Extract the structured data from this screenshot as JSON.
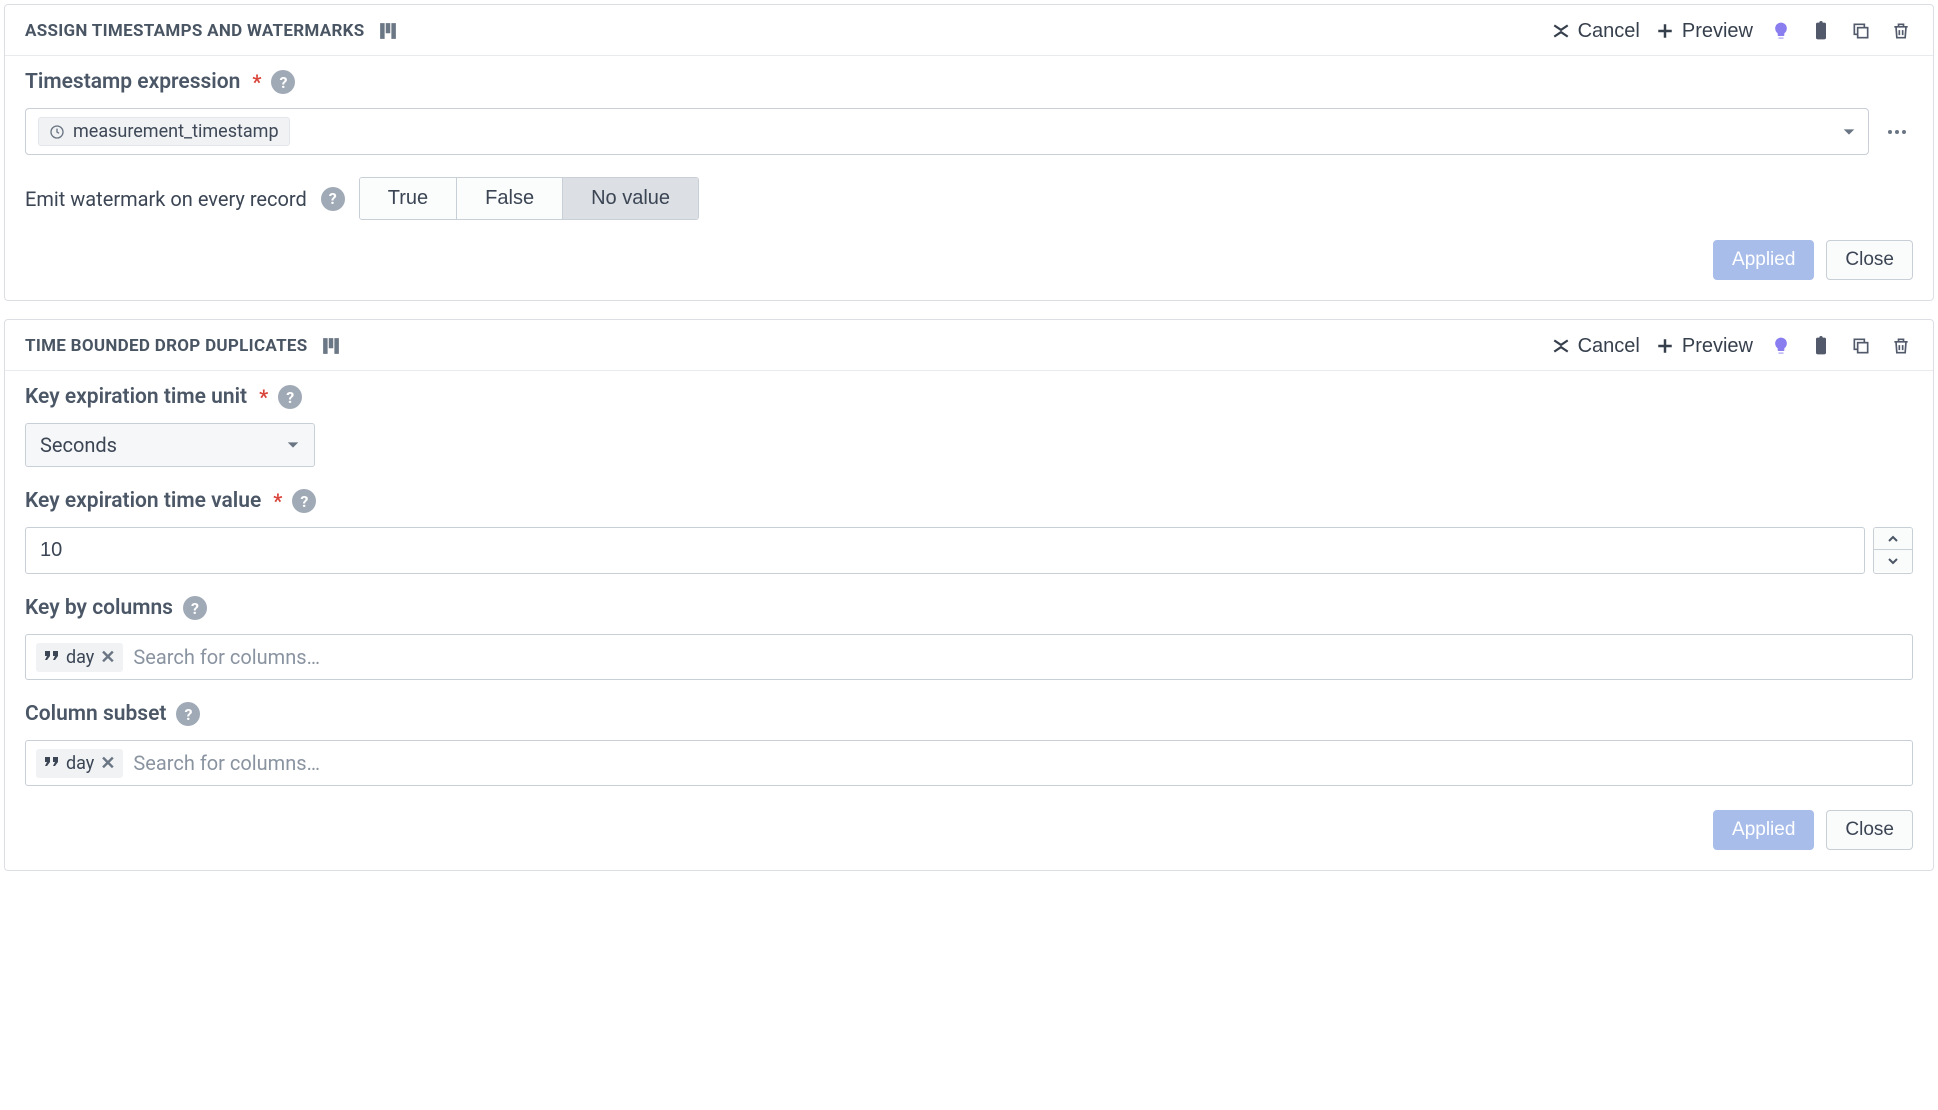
{
  "common": {
    "cancel": "Cancel",
    "preview": "Preview",
    "applied": "Applied",
    "close": "Close"
  },
  "panel1": {
    "title": "ASSIGN TIMESTAMPS AND WATERMARKS",
    "ts_label": "Timestamp expression",
    "ts_value": "measurement_timestamp",
    "emit_label": "Emit watermark on every record",
    "seg_true": "True",
    "seg_false": "False",
    "seg_none": "No value"
  },
  "panel2": {
    "title": "TIME BOUNDED DROP DUPLICATES",
    "unit_label": "Key expiration time unit",
    "unit_value": "Seconds",
    "value_label": "Key expiration time value",
    "value_value": "10",
    "keycols_label": "Key by columns",
    "keycols_tag": "day",
    "keycols_placeholder": "Search for columns…",
    "subset_label": "Column subset",
    "subset_tag": "day",
    "subset_placeholder": "Search for columns…"
  }
}
